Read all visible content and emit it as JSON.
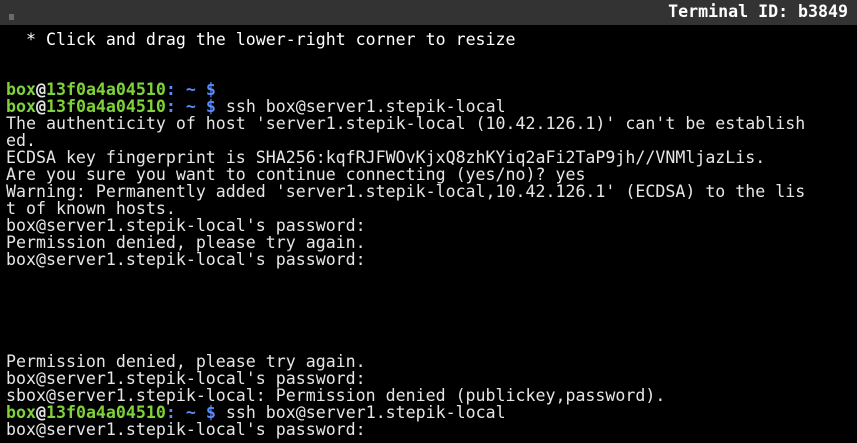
{
  "header": {
    "terminal_id": "Terminal ID: b3849"
  },
  "hint": " * Click and drag the lower-right corner to resize",
  "prompt": {
    "user": "box",
    "at": "@",
    "host": "13f0a4a04510",
    "sep": ": ",
    "path": "~ $",
    "colors": {
      "user": "#7fd23a",
      "path": "#5a8cff"
    }
  },
  "lines": [
    {
      "type": "prompt",
      "cmd": ""
    },
    {
      "type": "prompt",
      "cmd": " ssh box@server1.stepik-local"
    },
    {
      "type": "text",
      "text": "The authenticity of host 'server1.stepik-local (10.42.126.1)' can't be establish"
    },
    {
      "type": "text",
      "text": "ed."
    },
    {
      "type": "text",
      "text": "ECDSA key fingerprint is SHA256:kqfRJFWOvKjxQ8zhKYiq2aFi2TaP9jh//VNMljazLis."
    },
    {
      "type": "text",
      "text": "Are you sure you want to continue connecting (yes/no)? yes"
    },
    {
      "type": "text",
      "text": "Warning: Permanently added 'server1.stepik-local,10.42.126.1' (ECDSA) to the lis"
    },
    {
      "type": "text",
      "text": "t of known hosts."
    },
    {
      "type": "text",
      "text": "box@server1.stepik-local's password:"
    },
    {
      "type": "text",
      "text": "Permission denied, please try again."
    },
    {
      "type": "text",
      "text": "box@server1.stepik-local's password:"
    },
    {
      "type": "text",
      "text": ""
    },
    {
      "type": "text",
      "text": ""
    },
    {
      "type": "text",
      "text": ""
    },
    {
      "type": "text",
      "text": ""
    },
    {
      "type": "text",
      "text": ""
    },
    {
      "type": "text",
      "text": "Permission denied, please try again."
    },
    {
      "type": "text",
      "text": "box@server1.stepik-local's password:"
    },
    {
      "type": "text",
      "text": "sbox@server1.stepik-local: Permission denied (publickey,password)."
    },
    {
      "type": "prompt",
      "cmd": " ssh box@server1.stepik-local"
    },
    {
      "type": "text",
      "text": "box@server1.stepik-local's password:"
    }
  ]
}
